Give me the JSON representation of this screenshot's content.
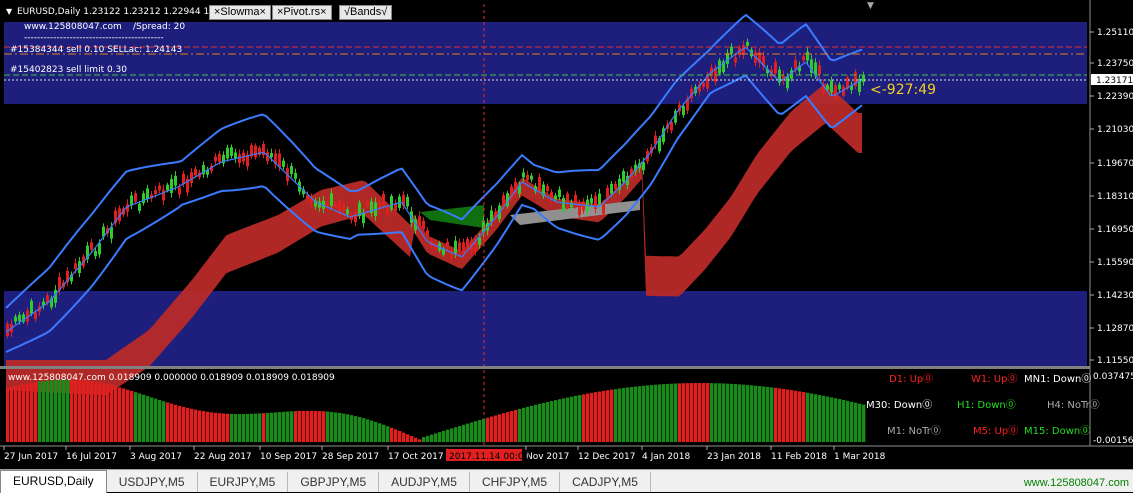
{
  "header": {
    "symbol_line": "EURUSD,Daily  1.23122 1.23212 1.22944 1.2",
    "site": "www.125808047.com",
    "spread": "/Spread:   20",
    "dash_line": "-------------------------------------------",
    "order1": "#15384344 sell 0.10   SELLac:  1.24143",
    "order2": "#15402823 sell limit 0.30",
    "countdown": "<-927:49"
  },
  "indicator_buttons": [
    {
      "label": "×Slowma×"
    },
    {
      "label": "×Pivot.rs×"
    },
    {
      "label": "√Bands√"
    }
  ],
  "price_axis": {
    "labels": [
      "1.25110",
      "1.23750",
      "1.23171",
      "1.22390",
      "1.21030",
      "1.19670",
      "1.18310",
      "1.16950",
      "1.15590",
      "1.14230",
      "1.12870",
      "1.11550"
    ],
    "current": "1.23171"
  },
  "sub_window": {
    "title": "www.125808047.com 0.018909 0.000000 0.018909 0.018909 0.018909",
    "scale_top": "0.037475",
    "scale_bottom": "-0.001560"
  },
  "timeframes": [
    {
      "label": "D1: Up",
      "color": "#ff2020"
    },
    {
      "label": "W1: Up",
      "color": "#ff2020"
    },
    {
      "label": "MN1: Down",
      "color": "#ffffff"
    },
    {
      "label": "M30: Down",
      "color": "#ffffff"
    },
    {
      "label": "H1: Down",
      "color": "#22dd22"
    },
    {
      "label": "H4: NoTr",
      "color": "#aaaaaa"
    },
    {
      "label": "M1: NoTr",
      "color": "#aaaaaa"
    },
    {
      "label": "M5: Up",
      "color": "#ff2020"
    },
    {
      "label": "M15: Down",
      "color": "#22dd22"
    }
  ],
  "time_axis": {
    "labels": [
      "27 Jun 2017",
      "16 Jul 2017",
      "3 Aug 2017",
      "22 Aug 2017",
      "10 Sep 2017",
      "28 Sep 2017",
      "17 Oct 2017",
      "Nov 2017",
      "12 Dec 2017",
      "4 Jan 2018",
      "23 Jan 2018",
      "11 Feb 2018",
      "1 Mar 2018"
    ],
    "highlight": "2017.11.14 00:00"
  },
  "tabs": [
    "EURUSD,Daily",
    "USDJPY,M5",
    "EURJPY,M5",
    "GBPJPY,M5",
    "AUDJPY,M5",
    "CHFJPY,M5",
    "CADJPY,M5"
  ],
  "footer": {
    "site": "www.125808047.com"
  },
  "colors": {
    "bg": "#000000",
    "band": "#1c1c7a",
    "bull": "#2ecc2e",
    "bear": "#e02020",
    "bollinger": "#3b7bff",
    "cloud": "#c0302a"
  }
}
